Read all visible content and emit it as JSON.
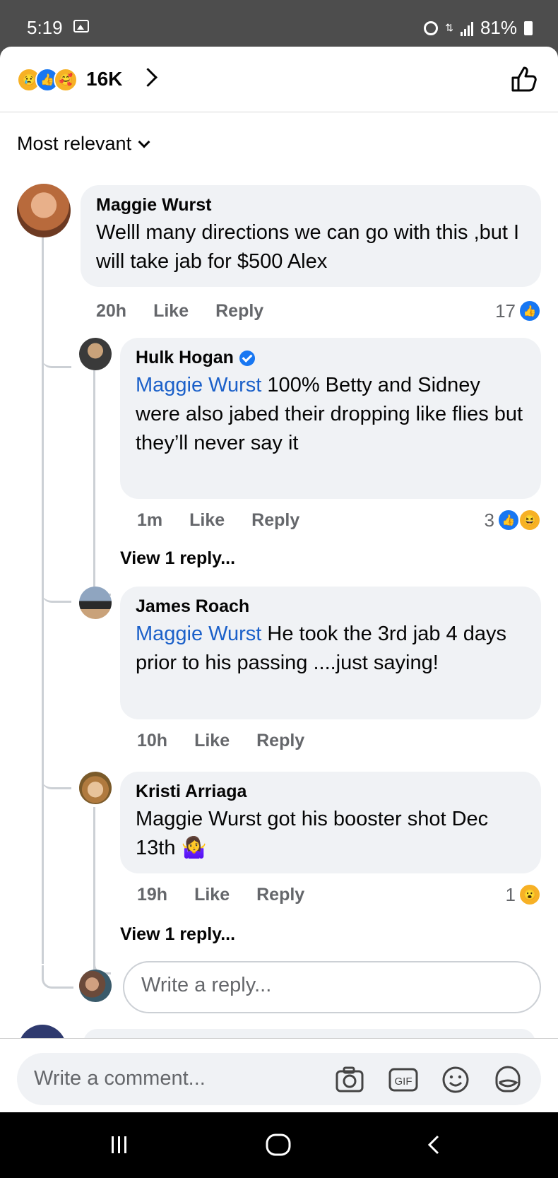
{
  "status": {
    "time": "5:19",
    "battery": "81%"
  },
  "header": {
    "reactions": [
      "sad",
      "like",
      "care"
    ],
    "count": "16K",
    "sort_label": "Most relevant"
  },
  "comments": [
    {
      "author": "Maggie Wurst",
      "text": "Welll many directions we can go with this ,but I will take jab for $500 Alex",
      "time": "20h",
      "like": "Like",
      "reply": "Reply",
      "reaction_count": "17"
    }
  ],
  "replies": [
    {
      "author": "Hulk Hogan",
      "mention": "Maggie Wurst",
      "text": " 100% Betty and Sidney were also jabed their dropping like flies but they’ll never say it",
      "time": "1m",
      "like": "Like",
      "reply": "Reply",
      "reaction_count": "3",
      "view_replies": "View 1 reply..."
    },
    {
      "author": "James Roach",
      "mention": "Maggie Wurst",
      "text": " He took the 3rd jab 4 days prior to his passing ....just saying!",
      "time": "10h",
      "like": "Like",
      "reply": "Reply"
    },
    {
      "author": "Kristi Arriaga",
      "text": "Maggie Wurst got his booster shot Dec 13th 🤷‍♀️",
      "time": "19h",
      "like": "Like",
      "reply": "Reply",
      "reaction_count": "1",
      "view_replies": "View 1 reply..."
    }
  ],
  "reply_input": {
    "placeholder": "Write a reply..."
  },
  "comment_input": {
    "placeholder": "Write a comment..."
  },
  "icons": {
    "camera": "camera-icon",
    "gif": "GIF",
    "emoji": "emoji-icon",
    "sticker": "sticker-icon"
  },
  "colors": {
    "accent": "#1877f2",
    "mention": "#1b60c9",
    "bubble": "#f0f2f5"
  }
}
